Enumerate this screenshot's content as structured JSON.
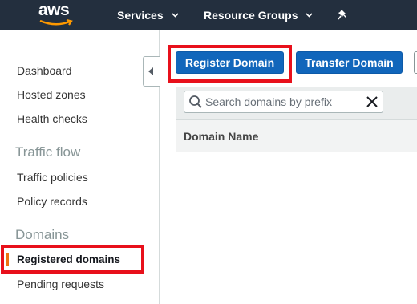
{
  "topnav": {
    "logo_text": "aws",
    "services_label": "Services",
    "resource_groups_label": "Resource Groups"
  },
  "sidebar": {
    "dashboard": "Dashboard",
    "hosted_zones": "Hosted zones",
    "health_checks": "Health checks",
    "traffic_flow_heading": "Traffic flow",
    "traffic_policies": "Traffic policies",
    "policy_records": "Policy records",
    "domains_heading": "Domains",
    "registered_domains": "Registered domains",
    "pending_requests": "Pending requests"
  },
  "toolbar": {
    "register_label": "Register Domain",
    "transfer_label": "Transfer Domain"
  },
  "search": {
    "placeholder": "Search domains by prefix"
  },
  "table": {
    "columns": [
      "Domain Name"
    ]
  },
  "colors": {
    "nav_bg": "#232f3e",
    "accent_orange": "#ec7211",
    "button_blue": "#1166bb",
    "highlight_red": "#e8101b"
  }
}
